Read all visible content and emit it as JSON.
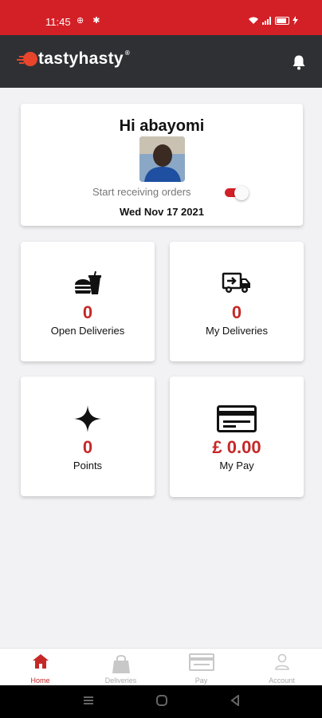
{
  "status_bar": {
    "time": "11:45",
    "left_icons": "⊕ ✱",
    "battery": "90"
  },
  "app_bar": {
    "brand": "tastyhasty",
    "trademark": "®",
    "notification_icon": "bell-icon"
  },
  "profile": {
    "greeting": "Hi abayomi",
    "receiving_label": "Start receiving orders",
    "receiving_on": true,
    "date": "Wed Nov 17 2021"
  },
  "tiles": [
    {
      "icon": "food-drink-icon",
      "value": "0",
      "label": "Open Deliveries"
    },
    {
      "icon": "delivery-truck-icon",
      "value": "0",
      "label": "My Deliveries"
    },
    {
      "icon": "sparkle-icon",
      "value": "0",
      "label": "Points"
    },
    {
      "icon": "card-icon",
      "value": "£ 0.00",
      "label": "My Pay"
    }
  ],
  "bottom_nav": [
    {
      "icon": "home-icon",
      "label": "Home",
      "active": true
    },
    {
      "icon": "bag-icon",
      "label": "Deliveries",
      "active": false
    },
    {
      "icon": "card-icon",
      "label": "Pay",
      "active": false
    },
    {
      "icon": "person-icon",
      "label": "Account",
      "active": false
    }
  ],
  "colors": {
    "brand_red": "#d32027",
    "value_red": "#c62828",
    "app_bar": "#2f3033",
    "background": "#f2f2f5"
  }
}
